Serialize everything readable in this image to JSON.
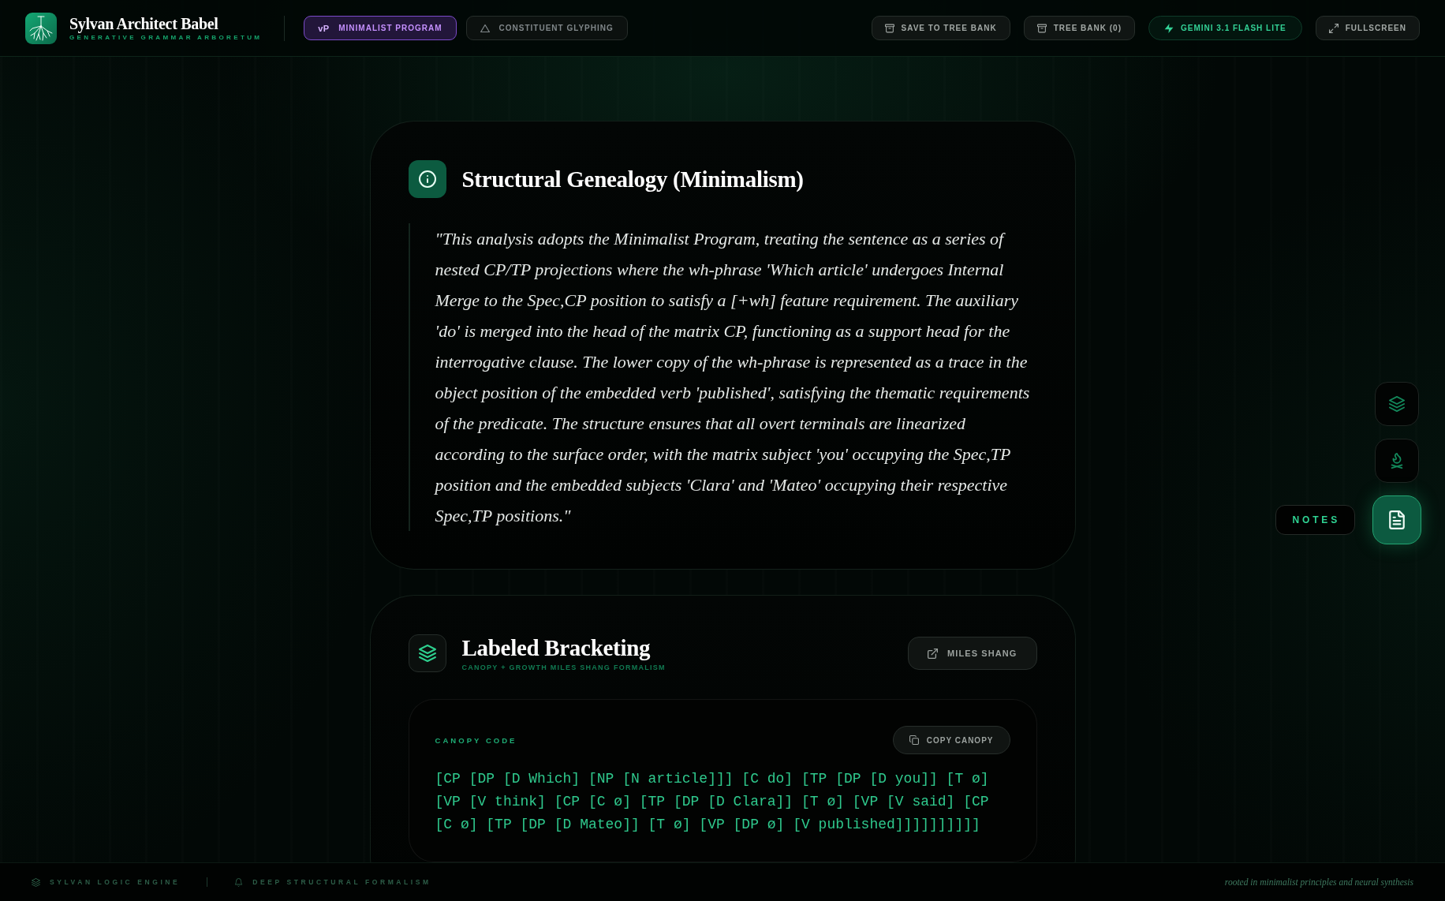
{
  "header": {
    "logo": {
      "title": "Sylvan Architect Babel",
      "subtitle": "GENERATIVE GRAMMAR ARBORETUM"
    },
    "modes": [
      {
        "badge": "vP",
        "label": "MINIMALIST PROGRAM",
        "selected": true
      },
      {
        "label": "CONSTITUENT GLYPHING",
        "selected": false
      }
    ],
    "actions": [
      {
        "label": "SAVE TO TREE BANK",
        "kind": "action"
      },
      {
        "label": "TREE BANK (0)",
        "kind": "action"
      },
      {
        "label": "GEMINI 3.1 FLASH LITE",
        "kind": "model"
      },
      {
        "label": "FULLSCREEN",
        "kind": "action"
      }
    ]
  },
  "genealogy": {
    "title": "Structural Genealogy (Minimalism)",
    "quote": "\"This analysis adopts the Minimalist Program, treating the sentence as a series of nested CP/TP projections where the wh-phrase 'Which article' undergoes Internal Merge to the Spec,CP position to satisfy a [+wh] feature requirement. The auxiliary 'do' is merged into the head of the matrix CP, functioning as a support head for the interrogative clause. The lower copy of the wh-phrase is represented as a trace in the object position of the embedded verb 'published', satisfying the thematic requirements of the predicate. The structure ensures that all overt terminals are linearized according to the surface order, with the matrix subject 'you' occupying the Spec,TP position and the embedded subjects 'Clara' and 'Mateo' occupying their respective Spec,TP positions.\""
  },
  "bracketing": {
    "title": "Labeled Bracketing",
    "subtitle": "CANOPY + GROWTH MILES SHANG FORMALISM",
    "link_button": "MILES SHANG",
    "code_label": "CANOPY CODE",
    "copy_button": "COPY CANOPY",
    "code": "[CP [DP [D Which] [NP [N article]]] [C do] [TP [DP [D you]] [T ø] [VP [V think] [CP [C ø] [TP [DP [D Clara]] [T ø] [VP [V said] [CP [C ø] [TP [DP [D Mateo]] [T ø] [VP [DP ø] [V published]]]]]]]]]]"
  },
  "dock": {
    "items": [
      {
        "selected": false
      },
      {
        "selected": false
      },
      {
        "selected": true,
        "tooltip": "NOTES"
      }
    ]
  },
  "footer": {
    "items": [
      "SYLVAN LOGIC ENGINE",
      "DEEP STRUCTURAL FORMALISM"
    ],
    "tagline": "rooted in minimalist principles and neural synthesis"
  }
}
